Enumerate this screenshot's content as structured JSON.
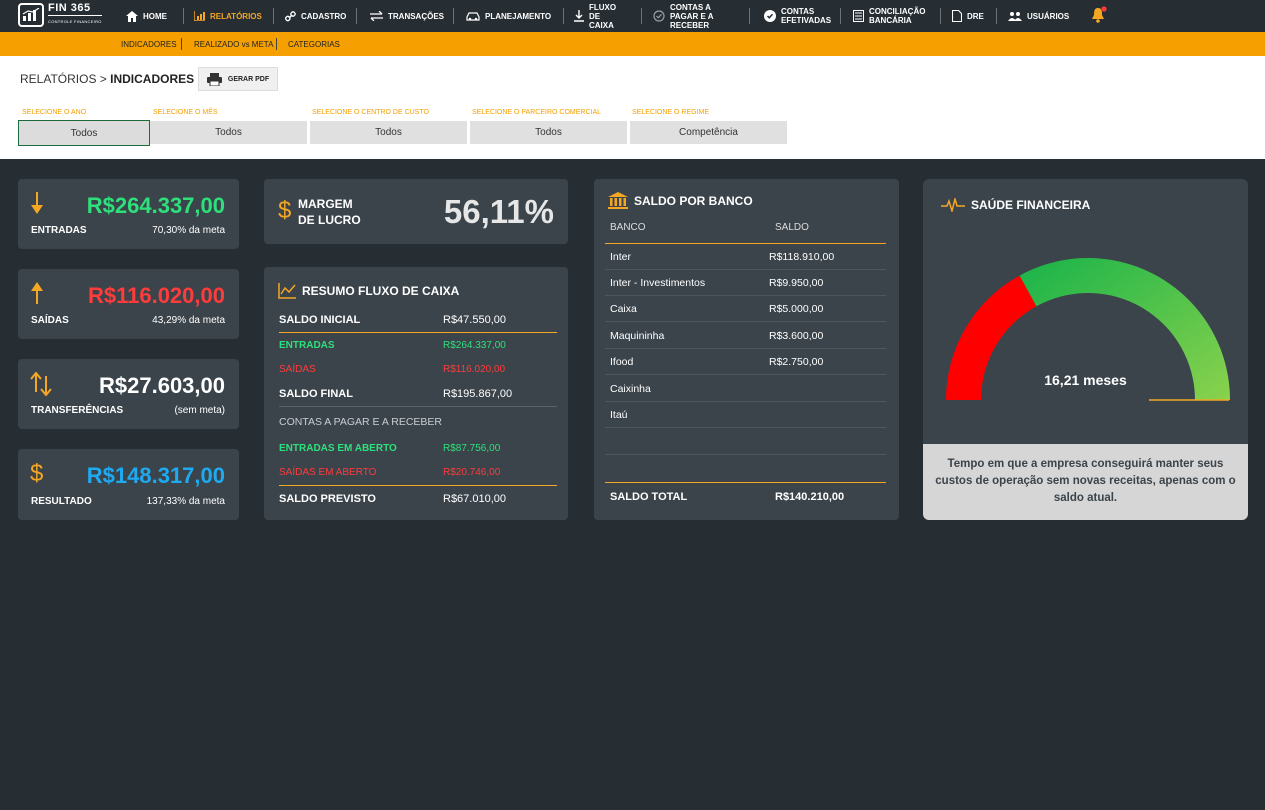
{
  "brand": {
    "name": "FIN 365",
    "tagline": "CONTROLE FINANCEIRO"
  },
  "nav": [
    {
      "label": "HOME",
      "icon": "home-icon"
    },
    {
      "label": "RELATÓRIOS",
      "icon": "chart-icon",
      "active": true
    },
    {
      "label": "CADASTRO",
      "icon": "link-icon"
    },
    {
      "label": "TRANSAÇÕES",
      "icon": "arrows-icon"
    },
    {
      "label": "PLANEJAMENTO",
      "icon": "car-icon"
    },
    {
      "label": "FLUXO DE CAIXA",
      "icon": "cash-flow-icon"
    },
    {
      "label": "CONTAS A PAGAR E A RECEBER",
      "icon": "check-circle-outline-icon"
    },
    {
      "label": "CONTAS EFETIVADAS",
      "icon": "check-circle-icon"
    },
    {
      "label": "CONCILIAÇÃO BANCÁRIA",
      "icon": "bank-statement-icon"
    },
    {
      "label": "DRE",
      "icon": "document-icon"
    },
    {
      "label": "USUÁRIOS",
      "icon": "users-icon"
    }
  ],
  "subnav": [
    "INDICADORES",
    "REALIZADO vs META",
    "CATEGORIAS"
  ],
  "breadcrumb": {
    "parent": "RELATÓRIOS > ",
    "current": "INDICADORES"
  },
  "pdf_button": "GERAR PDF",
  "filters": [
    {
      "label": "SELECIONE O ANO",
      "value": "Todos"
    },
    {
      "label": "SELECIONE O MÊS",
      "value": "Todos"
    },
    {
      "label": "SELECIONE O CENTRO DE CUSTO",
      "value": "Todos"
    },
    {
      "label": "SELECIONE O PARCEIRO COMERCIAL",
      "value": "Todos"
    },
    {
      "label": "SELECIONE O REGIME",
      "value": "Competência"
    }
  ],
  "kpis": {
    "entradas": {
      "value": "R$264.337,00",
      "label": "ENTRADAS",
      "sub": "70,30% da meta",
      "color": "#2ee07b"
    },
    "saidas": {
      "value": "R$116.020,00",
      "label": "SAÍDAS",
      "sub": "43,29% da meta",
      "color": "#ff3b3b"
    },
    "transferencias": {
      "value": "R$27.603,00",
      "label": "TRANSFERÊNCIAS",
      "sub": "(sem meta)",
      "color": "#ffffff"
    },
    "resultado": {
      "value": "R$148.317,00",
      "label": "RESULTADO",
      "sub": "137,33% da meta",
      "color": "#1eaaf1"
    }
  },
  "margem": {
    "label_1": "MARGEM",
    "label_2": "DE LUCRO",
    "value": "56,11%"
  },
  "resumo": {
    "title": "RESUMO FLUXO DE CAIXA",
    "saldo_inicial": {
      "k": "SALDO INICIAL",
      "v": "R$47.550,00"
    },
    "entradas": {
      "k": "ENTRADAS",
      "v": "R$264.337,00"
    },
    "saidas": {
      "k": "SAÍDAS",
      "v": "R$116.020,00"
    },
    "saldo_final": {
      "k": "SALDO FINAL",
      "v": "R$195.867,00"
    },
    "contas_title": "CONTAS A PAGAR E A RECEBER",
    "entradas_aberto": {
      "k": "ENTRADAS EM ABERTO",
      "v": "R$87.756,00"
    },
    "saidas_aberto": {
      "k": "SAÍDAS EM ABERTO",
      "v": "R$20.746,00"
    },
    "saldo_previsto": {
      "k": "SALDO PREVISTO",
      "v": "R$67.010,00"
    }
  },
  "bancos": {
    "title": "SALDO POR BANCO",
    "headers": [
      "BANCO",
      "SALDO"
    ],
    "rows": [
      {
        "banco": "Inter",
        "saldo": "R$118.910,00"
      },
      {
        "banco": "Inter - Investimentos",
        "saldo": "R$9.950,00"
      },
      {
        "banco": "Caixa",
        "saldo": "R$5.000,00"
      },
      {
        "banco": "Maquininha",
        "saldo": "R$3.600,00"
      },
      {
        "banco": "Ifood",
        "saldo": "R$2.750,00"
      },
      {
        "banco": "Caixinha",
        "saldo": ""
      },
      {
        "banco": "Itaú",
        "saldo": ""
      },
      {
        "banco": "",
        "saldo": ""
      }
    ],
    "total": {
      "k": "SALDO TOTAL",
      "v": "R$140.210,00"
    }
  },
  "saude": {
    "title": "SAÚDE FINANCEIRA",
    "value": "16,21 meses",
    "gauge_fraction": 0.66,
    "description": "Tempo em que a empresa conseguirá manter seus custos de operação sem novas receitas, apenas com o saldo atual."
  }
}
